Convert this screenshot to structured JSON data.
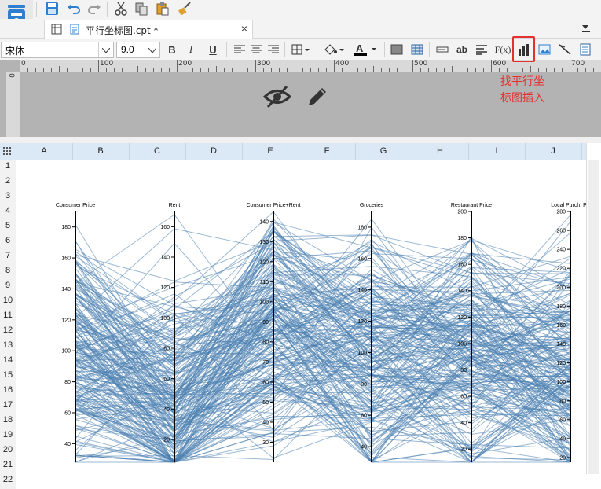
{
  "toolbar": {
    "icons": [
      "save-icon",
      "undo-icon",
      "redo-icon",
      "cut-icon",
      "copy-icon",
      "paste-icon",
      "format-brush-icon"
    ]
  },
  "tab": {
    "title": "平行坐标图.cpt *",
    "close": "×"
  },
  "format": {
    "font_name": "宋体",
    "font_size": "9.0",
    "bold": "B",
    "italic": "I",
    "underline": "U",
    "formula": "F(x)",
    "text_label": "ab"
  },
  "ruler": {
    "ticks": [
      "0",
      "100",
      "200",
      "300",
      "400",
      "500",
      "600",
      "700"
    ],
    "vertical": "0"
  },
  "annotation": {
    "text_line1": "找平行坐",
    "text_line2": "标图插入"
  },
  "sheet": {
    "columns": [
      "A",
      "B",
      "C",
      "D",
      "E",
      "F",
      "G",
      "H",
      "I",
      "J"
    ],
    "rows": [
      "1",
      "2",
      "3",
      "4",
      "5",
      "6",
      "7",
      "8",
      "9",
      "10",
      "11",
      "12",
      "13",
      "14",
      "15",
      "16",
      "17",
      "18",
      "19",
      "20",
      "21",
      "22"
    ]
  },
  "chart_data": {
    "type": "parallel-coordinates",
    "color": "#4a7fb0",
    "axes": [
      {
        "name": "Consumer Price",
        "ticks": [
          "40",
          "60",
          "80",
          "100",
          "120",
          "140",
          "160",
          "180"
        ],
        "range": [
          28,
          190
        ]
      },
      {
        "name": "Rent",
        "ticks": [
          "20",
          "40",
          "60",
          "80",
          "100",
          "120",
          "140",
          "160"
        ],
        "range": [
          5,
          170
        ]
      },
      {
        "name": "Consumer Price+Rent",
        "ticks": [
          "30",
          "40",
          "50",
          "60",
          "70",
          "80",
          "90",
          "100",
          "110",
          "120",
          "130",
          "140"
        ],
        "range": [
          20,
          145
        ]
      },
      {
        "name": "Groceries",
        "ticks": [
          "40",
          "60",
          "80",
          "100",
          "120",
          "140",
          "160",
          "180"
        ],
        "range": [
          30,
          190
        ]
      },
      {
        "name": "Restaurant Price",
        "ticks": [
          "20",
          "40",
          "60",
          "80",
          "100",
          "120",
          "140",
          "160",
          "180",
          "200"
        ],
        "range": [
          10,
          200
        ]
      },
      {
        "name": "Local Purch. Po",
        "ticks": [
          "20",
          "40",
          "60",
          "80",
          "100",
          "120",
          "140",
          "160",
          "180",
          "200",
          "220",
          "240",
          "260",
          "280"
        ],
        "range": [
          15,
          280
        ]
      }
    ]
  }
}
